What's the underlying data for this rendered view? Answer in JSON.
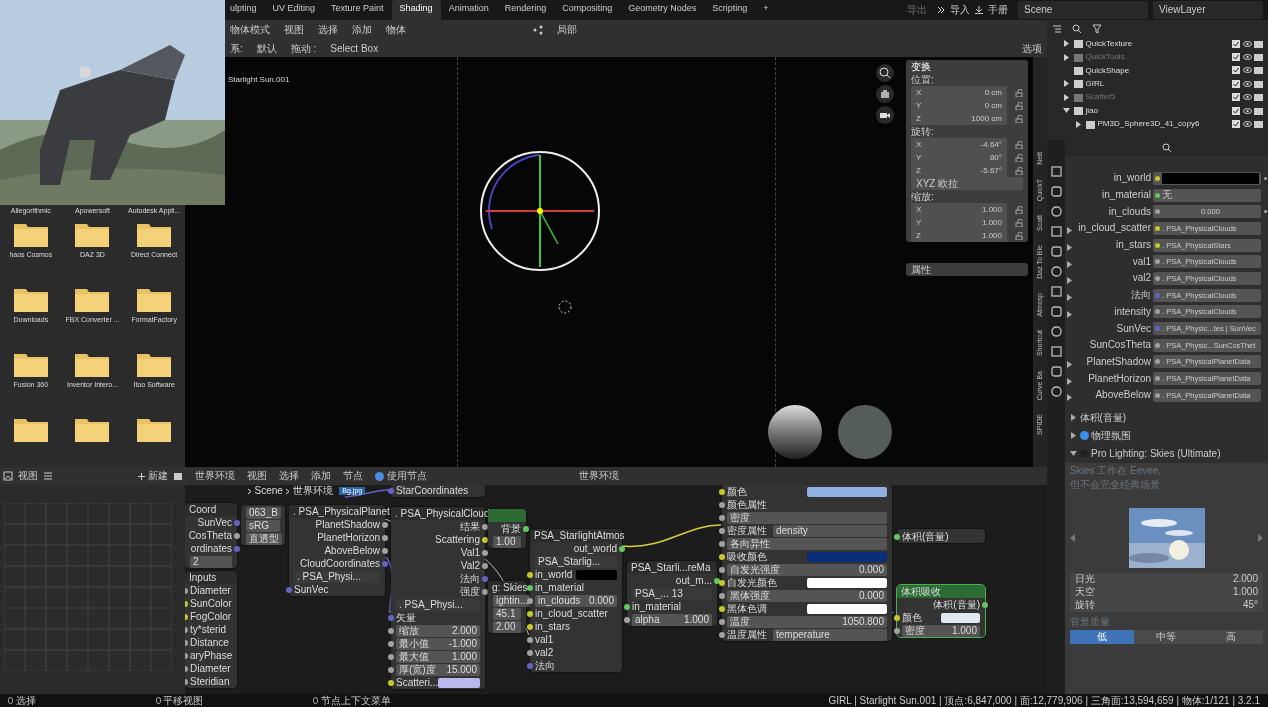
{
  "workspace_tabs": [
    {
      "label": "ulpting",
      "selected": false
    },
    {
      "label": "UV Editing",
      "selected": false
    },
    {
      "label": "Texture Paint",
      "selected": false
    },
    {
      "label": "Shading",
      "selected": true
    },
    {
      "label": "Animation",
      "selected": false
    },
    {
      "label": "Rendering",
      "selected": false
    },
    {
      "label": "Compositing",
      "selected": false
    },
    {
      "label": "Geometry Nodes",
      "selected": false
    },
    {
      "label": "Scripting",
      "selected": false
    },
    {
      "label": "+",
      "selected": false
    }
  ],
  "top_right": {
    "export": "导出",
    "import": "导入",
    "manual": "手册",
    "scene": "Scene",
    "view_layer": "ViewLayer"
  },
  "viewport_header": {
    "mode": "物体模式",
    "menus": [
      "视图",
      "选择",
      "添加",
      "物体"
    ],
    "pivot": "局部",
    "orientation_label": "系:",
    "orientation": "默认",
    "drag_label": "拖动 :",
    "drag": "Select Box",
    "options": "选项"
  },
  "viewport": {
    "object_label": "Starlight Sun.001"
  },
  "transform_panel": {
    "title": "变换",
    "location_label": "位置:",
    "location": [
      {
        "axis": "X",
        "value": "0 cm"
      },
      {
        "axis": "Y",
        "value": "0 cm"
      },
      {
        "axis": "Z",
        "value": "1000 cm"
      }
    ],
    "rotation_label": "旋转:",
    "rotation": [
      {
        "axis": "X",
        "value": "-4.64°"
      },
      {
        "axis": "Y",
        "value": "80°"
      },
      {
        "axis": "Z",
        "value": "-5.67°"
      }
    ],
    "rotation_mode": "XYZ 欧拉",
    "scale_label": "缩放:",
    "scale": [
      {
        "axis": "X",
        "value": "1.000"
      },
      {
        "axis": "Y",
        "value": "1.000"
      },
      {
        "axis": "Z",
        "value": "1.000"
      }
    ],
    "properties_title": "属性"
  },
  "sidebar_tabs": [
    "Nett",
    "QuickT",
    "Scatt",
    "Daz To Ble",
    "Atmosp",
    "Shortcut",
    "Curve Ba",
    "SPIDE"
  ],
  "outliner": [
    {
      "name": "QuickTexture",
      "expanded": false,
      "enabled": true
    },
    {
      "name": "QuickTools",
      "expanded": false,
      "enabled": false
    },
    {
      "name": "QuickShape",
      "enabled": true
    },
    {
      "name": "GIRL",
      "expanded": false,
      "enabled": true
    },
    {
      "name": "Scatter5",
      "expanded": false,
      "enabled": false
    },
    {
      "name": "jiao",
      "expanded": true,
      "enabled": true,
      "children": [
        {
          "name": "PM3D_Sphere3D_41_copy6",
          "expanded": false,
          "enabled": true
        }
      ]
    }
  ],
  "properties_rows": [
    {
      "label": "in_world",
      "kind": "color",
      "swatch": {
        "color": "#000000"
      },
      "color": "#c7c729"
    },
    {
      "label": "in_material",
      "kind": "text",
      "value": "无",
      "color": "#63c763"
    },
    {
      "label": "in_clouds",
      "kind": "number",
      "value": "0.000",
      "color": "#a1a1a1"
    },
    {
      "label": "in_cloud_scatter",
      "kind": "link",
      "value": ". PSA_PhysicalClouds",
      "color": "#c7c729",
      "expanded": false
    },
    {
      "label": "in_stars",
      "kind": "link",
      "value": ". PSA_PhysicalStars",
      "color": "#c7c729",
      "expanded": false
    },
    {
      "label": "val1",
      "kind": "link",
      "value": ". PSA_PhysicalClouds",
      "color": "#a1a1a1",
      "expanded": false
    },
    {
      "label": "val2",
      "kind": "link",
      "value": ". PSA_PhysicalClouds",
      "color": "#a1a1a1",
      "expanded": false
    },
    {
      "label": "法向",
      "kind": "link",
      "value": ". PSA_PhysicalClouds",
      "color": "#6363c7",
      "expanded": false
    },
    {
      "label": "intensity",
      "kind": "link",
      "value": ". PSA_PhysicalClouds",
      "color": "#a1a1a1",
      "expanded": false
    },
    {
      "label": "SunVec",
      "kind": "link",
      "value": ". PSA_Physic...tes | SunVec",
      "color": "#6363c7"
    },
    {
      "label": "SunCosTheta",
      "kind": "link",
      "value": ". PSA_Physic...SunCosThet",
      "color": "#a1a1a1"
    },
    {
      "label": "PlanetShadow",
      "kind": "link",
      "value": ". PSA_PhysicalPlanetData",
      "color": "#a1a1a1",
      "expanded": false
    },
    {
      "label": "PlanetHorizon",
      "kind": "link",
      "value": ". PSA_PhysicalPlanetData",
      "color": "#a1a1a1",
      "expanded": false
    },
    {
      "label": "AboveBelow",
      "kind": "link",
      "value": ". PSA_PhysicalPlanetData",
      "color": "#a1a1a1",
      "expanded": false
    }
  ],
  "properties_sections": [
    {
      "title": "体积(音量)",
      "expanded": false
    },
    {
      "title": "物理氛围",
      "expanded": false,
      "color": "#3a8ee6"
    },
    {
      "title": "Pro Lighting: Skies (Ultimate)",
      "expanded": true,
      "color": "#222222"
    }
  ],
  "skies_panel": {
    "note": [
      "Skies 工作在 Eevee,",
      "但不会完全经典场景"
    ],
    "params": [
      {
        "label": "日光",
        "value": "2.000"
      },
      {
        "label": "天空",
        "value": "1.000"
      },
      {
        "label": "旋转",
        "value": "45°"
      }
    ],
    "quality_label": "背景质量",
    "quality": [
      {
        "label": "低",
        "selected": true
      },
      {
        "label": "中等",
        "selected": false
      },
      {
        "label": "高",
        "selected": false
      }
    ]
  },
  "explorer": {
    "items": [
      {
        "label": "Allegorithmic",
        "kind": "label"
      },
      {
        "label": "Apowersoft",
        "kind": "label"
      },
      {
        "label": "Autodesk Appli...",
        "kind": "label"
      },
      {
        "label": "haos Cosmos",
        "kind": "folder"
      },
      {
        "label": "DAZ 3D",
        "kind": "folder"
      },
      {
        "label": "Direct Connect",
        "kind": "folder"
      },
      {
        "label": "Downloads",
        "kind": "folder"
      },
      {
        "label": "FBX Converter ...",
        "kind": "folder"
      },
      {
        "label": "FormatFactory",
        "kind": "folder"
      },
      {
        "label": "Fusion 360",
        "kind": "folder"
      },
      {
        "label": "Inventor Intero...",
        "kind": "folder"
      },
      {
        "label": "Itoo Software",
        "kind": "folder"
      },
      {
        "kind": "folder"
      },
      {
        "kind": "folder"
      },
      {
        "kind": "folder"
      }
    ]
  },
  "image_editor": {
    "view": "视图",
    "new": "新建"
  },
  "node_editor": {
    "header_menus": [
      "世界环境",
      "视图",
      "选择",
      "添加",
      "节点"
    ],
    "use_nodes": {
      "label": "使用节点",
      "checked": true
    },
    "world": "世界环境",
    "breadcrumb": [
      "Scene",
      "世界环境"
    ],
    "image_name": "Bg.jpg",
    "nodes": [
      {
        "kind": "plain",
        "rows": [
          {
            "kind": "in",
            "label": "StarCoordinates",
            "color": "#6363c7"
          }
        ]
      },
      {
        "title": "Coord",
        "kind": "group",
        "rows": [
          {
            "kind": "out",
            "label": "SunVec",
            "color": "#6363c7"
          },
          {
            "kind": "out",
            "label": "CosTheta",
            "color": "#a1a1a1"
          },
          {
            "kind": "out",
            "label": "ordinates",
            "color": "#6363c7"
          },
          {
            "kind": "field",
            "value": "2"
          }
        ]
      },
      {
        "kind": "plain",
        "rows": [
          {
            "kind": "field",
            "value": "063_B"
          },
          {
            "kind": "field",
            "value": "sRG"
          },
          {
            "kind": "dropdown",
            "value": "直透型"
          }
        ]
      },
      {
        "title": "Inputs",
        "kind": "group",
        "rows": [
          {
            "kind": "in",
            "label": "Diameter",
            "color": "#a1a1a1"
          },
          {
            "kind": "in",
            "label": "SunColor",
            "color": "#c7c729"
          },
          {
            "kind": "in",
            "label": "FogColor",
            "color": "#c7c729"
          },
          {
            "kind": "in",
            "label": "ty*sterid",
            "color": "#a1a1a1"
          },
          {
            "kind": "in",
            "label": "Distance",
            "color": "#a1a1a1"
          },
          {
            "kind": "in",
            "label": "aryPhase",
            "color": "#a1a1a1"
          },
          {
            "kind": "in",
            "label": "Diameter",
            "color": "#a1a1a1"
          },
          {
            "kind": "in",
            "label": "Steridian",
            "color": "#a1a1a1"
          }
        ]
      },
      {
        "title": ". PSA_PhysicalPlanet",
        "kind": "group",
        "rows": [
          {
            "kind": "out",
            "label": "PlanetShadow",
            "color": "#a1a1a1"
          },
          {
            "kind": "out",
            "label": "PlanetHorizon",
            "color": "#a1a1a1"
          },
          {
            "kind": "out",
            "label": "AboveBelow",
            "color": "#a1a1a1"
          },
          {
            "kind": "out",
            "label": "CloudCoordinates",
            "color": "#6363c7"
          },
          {
            "kind": "data",
            "value": ". PSA_Physi..."
          },
          {
            "kind": "in",
            "label": "SunVec",
            "color": "#6363c7"
          }
        ]
      },
      {
        "title": ". PSA_PhysicalCloud",
        "kind": "group",
        "rows": [
          {
            "kind": "out",
            "label": "结果",
            "color": "#a1a1a1"
          },
          {
            "kind": "out",
            "label": "Scattering",
            "color": "#c7c729"
          },
          {
            "kind": "out",
            "label": "Val1",
            "color": "#a1a1a1"
          },
          {
            "kind": "out",
            "label": "Val2",
            "color": "#a1a1a1"
          },
          {
            "kind": "out",
            "label": "法向",
            "color": "#6363c7"
          },
          {
            "kind": "out",
            "label": "强度",
            "color": "#a1a1a1"
          },
          {
            "kind": "data",
            "value": ". PSA_Physi..."
          },
          {
            "kind": "in",
            "label": "矢量",
            "color": "#6363c7"
          },
          {
            "kind": "field",
            "label": "缩放",
            "value": "2.000",
            "color": "#a1a1a1"
          },
          {
            "kind": "field",
            "label": "最小值",
            "value": "-1.000",
            "color": "#a1a1a1"
          },
          {
            "kind": "field",
            "label": "最大值",
            "value": "1.000",
            "color": "#a1a1a1"
          },
          {
            "kind": "field",
            "label": "厚(宽)度",
            "value": "15.000",
            "color": "#a1a1a1"
          },
          {
            "kind": "color",
            "label": "Scatteri...",
            "swatch": {
              "color": "#b9b9ee"
            },
            "color": "#c7c729"
          }
        ]
      },
      {
        "kind": "shader",
        "rows": [
          {
            "kind": "out",
            "label": "背景",
            "color": "#63c763"
          },
          {
            "kind": "field",
            "value": "1.00"
          }
        ]
      },
      {
        "title": "g: Skies",
        "kind": "group",
        "rows": [
          {
            "kind": "field",
            "value": "ightin..."
          },
          {
            "kind": "field",
            "value": "45.1"
          },
          {
            "kind": "field",
            "value": "2.00"
          }
        ]
      },
      {
        "title": "PSA_StarlightAtmos",
        "kind": "group",
        "rows": [
          {
            "kind": "out",
            "label": "out_world",
            "color": "#63c763"
          },
          {
            "kind": "data",
            "value": "PSA_Starlig..."
          },
          {
            "kind": "color",
            "label": "in_world",
            "swatch": {
              "color": "#000000"
            },
            "color": "#c7c729"
          },
          {
            "kind": "in",
            "label": "in_material",
            "color": "#63c763"
          },
          {
            "kind": "field",
            "label": "in_clouds",
            "value": "0.000",
            "color": "#a1a1a1"
          },
          {
            "kind": "in",
            "label": "in_cloud_scatter",
            "color": "#c7c729"
          },
          {
            "kind": "in",
            "label": "in_stars",
            "color": "#c7c729"
          },
          {
            "kind": "in",
            "label": "val1",
            "color": "#a1a1a1"
          },
          {
            "kind": "in",
            "label": "val2",
            "color": "#a1a1a1"
          },
          {
            "kind": "in",
            "label": "法向",
            "color": "#6363c7"
          }
        ]
      },
      {
        "title": "PSA_Starli...reMa",
        "kind": "group",
        "rows": [
          {
            "kind": "out",
            "label": "out_m...",
            "color": "#63c763"
          },
          {
            "kind": "data",
            "value": "PSA_... 13"
          },
          {
            "kind": "in",
            "label": "in_material",
            "color": "#63c763"
          },
          {
            "kind": "field",
            "label": "alpha",
            "value": "1.000",
            "color": "#a1a1a1"
          }
        ]
      },
      {
        "kind": "plain",
        "rows": [
          {
            "kind": "color",
            "label": "颜色",
            "swatch": {
              "color": "#8fb0e0"
            },
            "color": "#c7c729"
          },
          {
            "kind": "prop",
            "label": "颜色属性",
            "color": "#a1a1a1"
          },
          {
            "kind": "field",
            "label": "密度",
            "color": "#a1a1a1"
          },
          {
            "kind": "prop",
            "label": "密度属性",
            "value": "density",
            "color": "#a1a1a1"
          },
          {
            "kind": "field",
            "label": "各向异性",
            "color": "#a1a1a1"
          },
          {
            "kind": "color",
            "label": "吸收颜色",
            "swatch": {
              "color": "#0b2e7a"
            },
            "color": "#c7c729"
          },
          {
            "kind": "field",
            "label": "自发光强度",
            "value": "0.000",
            "color": "#a1a1a1"
          },
          {
            "kind": "color",
            "label": "自发光颜色",
            "swatch": {
              "color": "#ffffff"
            },
            "color": "#c7c729"
          },
          {
            "kind": "field",
            "label": "黑体强度",
            "value": "0.000",
            "color": "#a1a1a1"
          },
          {
            "kind": "color",
            "label": "黑体色调",
            "swatch": {
              "color": "#ffffff"
            },
            "color": "#c7c729"
          },
          {
            "kind": "field",
            "label": "温度",
            "value": "1050.800",
            "color": "#a1a1a1"
          },
          {
            "kind": "prop",
            "label": "温度属性",
            "value": "temperature",
            "color": "#a1a1a1"
          }
        ]
      },
      {
        "kind": "plain",
        "rows": [
          {
            "kind": "in",
            "label": "体积(音量)",
            "color": "#63c763"
          }
        ]
      },
      {
        "title": "体积吸收",
        "kind": "shader",
        "selected": true,
        "rows": [
          {
            "kind": "out",
            "label": "体积(音量)",
            "color": "#63c763"
          },
          {
            "kind": "color",
            "label": "颜色",
            "swatch": {
              "color": "#dfe8ee"
            },
            "color": "#c7c729"
          },
          {
            "kind": "slider",
            "label": "密度",
            "value": "1.000",
            "color": "#a1a1a1"
          }
        ]
      }
    ]
  },
  "status_bar": {
    "actions": [
      "选择",
      "平移视图",
      "节点上下文菜单"
    ],
    "stats": "GIRL | Starlight Sun.001 | 顶点:6,847,000 | 面:12,779,906 | 三角面:13,594,659 | 物体:1/121 | 3.2.1"
  }
}
